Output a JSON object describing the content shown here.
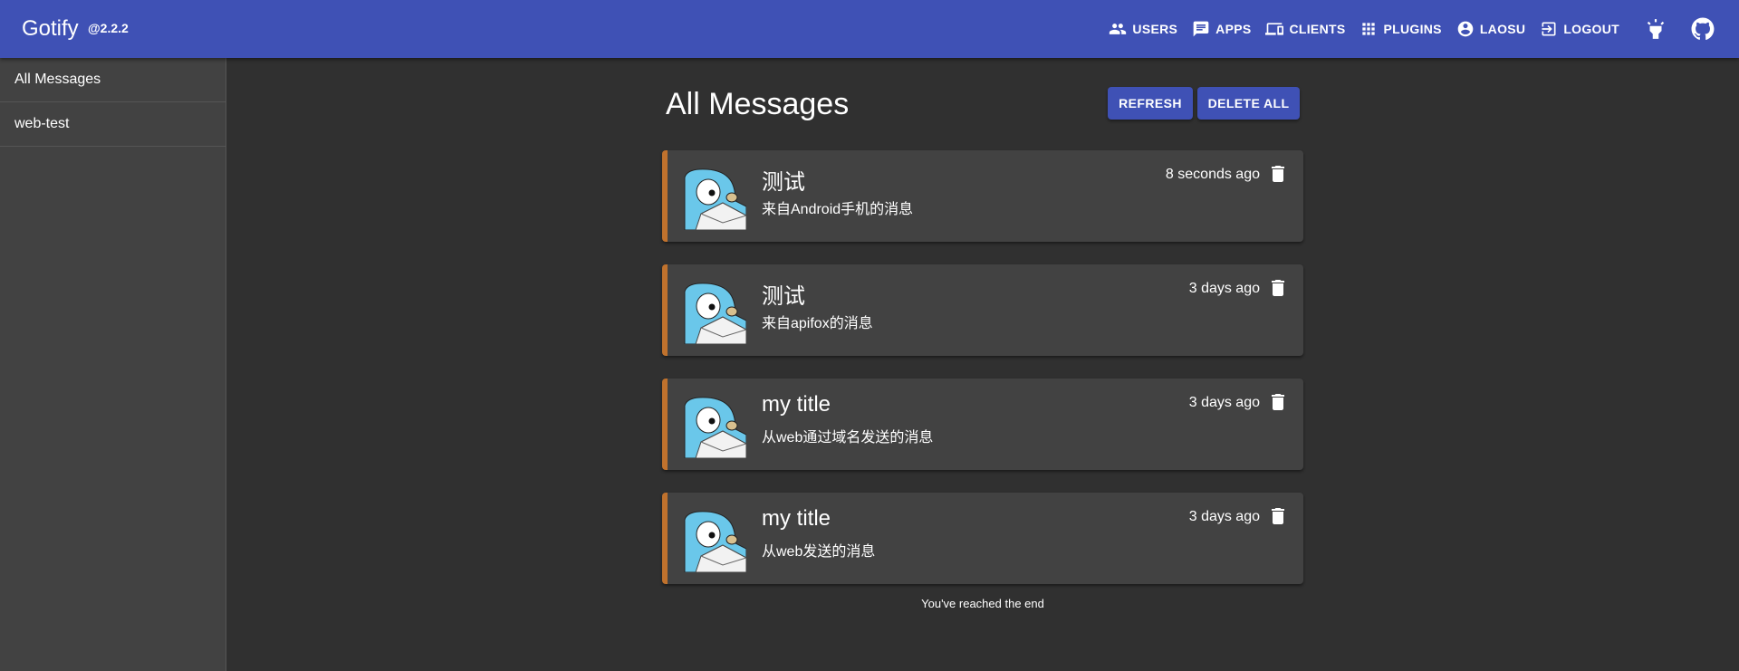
{
  "appbar": {
    "brand": "Gotify",
    "version": "@2.2.2",
    "nav": [
      {
        "name": "users",
        "label": "USERS",
        "icon": "users-icon"
      },
      {
        "name": "apps",
        "label": "APPS",
        "icon": "chat-icon"
      },
      {
        "name": "clients",
        "label": "CLIENTS",
        "icon": "devices-icon"
      },
      {
        "name": "plugins",
        "label": "PLUGINS",
        "icon": "apps-grid-icon"
      },
      {
        "name": "account",
        "label": "LAOSU",
        "icon": "account-circle-icon"
      },
      {
        "name": "logout",
        "label": "LOGOUT",
        "icon": "exit-icon"
      }
    ],
    "theme_icon": "lightbulb-icon",
    "github_icon": "github-icon"
  },
  "sidebar": {
    "items": [
      {
        "label": "All Messages"
      },
      {
        "label": "web-test"
      }
    ]
  },
  "main": {
    "title": "All Messages",
    "refresh_label": "REFRESH",
    "delete_all_label": "DELETE ALL",
    "messages": [
      {
        "title": "测试",
        "body": "来自Android手机的消息",
        "time": "8 seconds ago"
      },
      {
        "title": "测试",
        "body": "来自apifox的消息",
        "time": "3 days ago"
      },
      {
        "title": "my title",
        "body": "从web通过域名发送的消息",
        "time": "3 days ago"
      },
      {
        "title": "my title",
        "body": "从web发送的消息",
        "time": "3 days ago"
      }
    ],
    "end_note": "You've reached the end"
  },
  "colors": {
    "appbar": "#3f51b5",
    "background": "#303030",
    "card": "#424242",
    "priority_border": "#c0722d"
  }
}
